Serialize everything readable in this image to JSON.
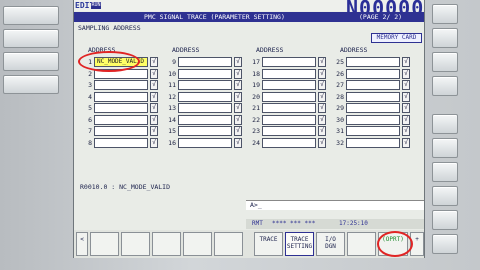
{
  "header": {
    "mode": "EDIT",
    "run_badge": "RUN",
    "program_number": "N00000",
    "title": "PMC SIGNAL TRACE (PARAMETER SETTING)",
    "page": "(PAGE  2/ 2)"
  },
  "labels": {
    "sampling_address": "SAMPLING ADDRESS",
    "memory_card": "MEMORY CARD",
    "column_header": "ADDRESS"
  },
  "address_rows": [
    {
      "num": "1",
      "value": "NC_MODE_VALID",
      "check": "√"
    },
    {
      "num": "2",
      "value": "",
      "check": "√"
    },
    {
      "num": "3",
      "value": "",
      "check": "√"
    },
    {
      "num": "4",
      "value": "",
      "check": "√"
    },
    {
      "num": "5",
      "value": "",
      "check": "√"
    },
    {
      "num": "6",
      "value": "",
      "check": "√"
    },
    {
      "num": "7",
      "value": "",
      "check": "√"
    },
    {
      "num": "8",
      "value": "",
      "check": "√"
    },
    {
      "num": "9",
      "value": "",
      "check": "√"
    },
    {
      "num": "10",
      "value": "",
      "check": "√"
    },
    {
      "num": "11",
      "value": "",
      "check": "√"
    },
    {
      "num": "12",
      "value": "",
      "check": "√"
    },
    {
      "num": "13",
      "value": "",
      "check": "√"
    },
    {
      "num": "14",
      "value": "",
      "check": "√"
    },
    {
      "num": "15",
      "value": "",
      "check": "√"
    },
    {
      "num": "16",
      "value": "",
      "check": "√"
    },
    {
      "num": "17",
      "value": "",
      "check": "√"
    },
    {
      "num": "18",
      "value": "",
      "check": "√"
    },
    {
      "num": "19",
      "value": "",
      "check": "√"
    },
    {
      "num": "20",
      "value": "",
      "check": "√"
    },
    {
      "num": "21",
      "value": "",
      "check": "√"
    },
    {
      "num": "22",
      "value": "",
      "check": "√"
    },
    {
      "num": "23",
      "value": "",
      "check": "√"
    },
    {
      "num": "24",
      "value": "",
      "check": "√"
    },
    {
      "num": "25",
      "value": "",
      "check": "√"
    },
    {
      "num": "26",
      "value": "",
      "check": "√"
    },
    {
      "num": "27",
      "value": "",
      "check": "√"
    },
    {
      "num": "28",
      "value": "",
      "check": "√"
    },
    {
      "num": "29",
      "value": "",
      "check": "√"
    },
    {
      "num": "30",
      "value": "",
      "check": "√"
    },
    {
      "num": "31",
      "value": "",
      "check": "√"
    },
    {
      "num": "32",
      "value": "",
      "check": "√"
    }
  ],
  "status_line": "R0010.0 : NC_MODE_VALID",
  "input_prompt": "A>_",
  "info": {
    "rmt": "RMT",
    "stars": "**** *** ***",
    "time": "17:25:10"
  },
  "softkeys": {
    "prev": "<",
    "trace": "TRACE",
    "trace_setting_1": "TRACE",
    "trace_setting_2": "SETTING",
    "io_1": "I/O",
    "io_2": "DGN",
    "oprt": "(OPRT)",
    "next": "+"
  },
  "colors": {
    "title_bar": "#2e3192",
    "selected_field": "#ffff66",
    "annotation": "#e02424"
  }
}
